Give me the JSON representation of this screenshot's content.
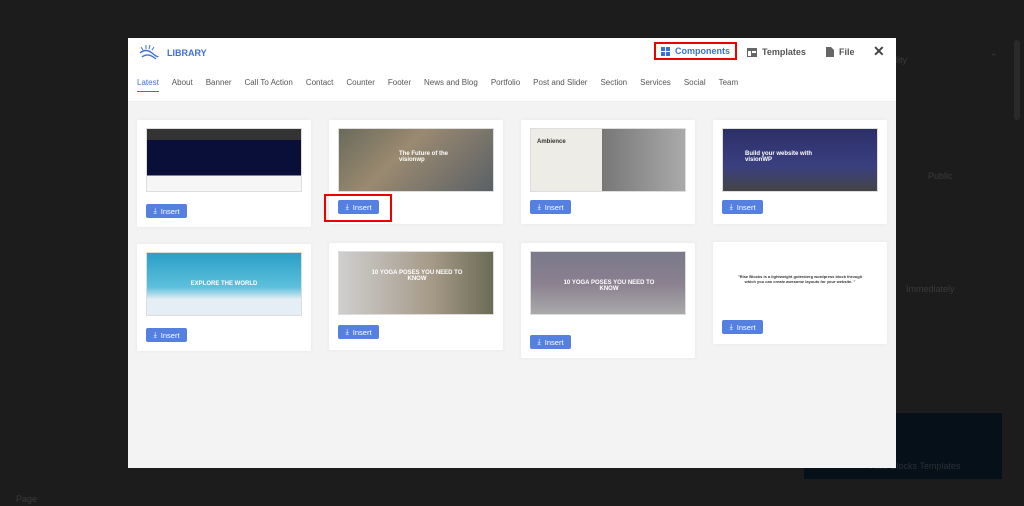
{
  "background": {
    "visibility": "lity",
    "public": "Public",
    "immediately": "Immediately",
    "templates": "Rise Blocks Templates",
    "page": "Page"
  },
  "header": {
    "title": "LIBRARY",
    "buttons": [
      {
        "label": "Components",
        "icon": "grid-icon",
        "active": true
      },
      {
        "label": "Templates",
        "icon": "template-icon"
      },
      {
        "label": "File",
        "icon": "file-icon"
      }
    ],
    "close_icon": "close-icon"
  },
  "tabs": [
    "Latest",
    "About",
    "Banner",
    "Call To Action",
    "Contact",
    "Counter",
    "Footer",
    "News and Blog",
    "Portfolio",
    "Post and Slider",
    "Section",
    "Services",
    "Social",
    "Team"
  ],
  "active_tab": "Latest",
  "insert_label": "Insert",
  "thumbs": {
    "t2": "The Future of the visionwp",
    "t3": "Ambience",
    "t4": "Build your website with visionWP",
    "t5": "EXPLORE THE WORLD",
    "t6": "10 YOGA POSES YOU NEED TO KNOW",
    "t7": "10 YOGA POSES YOU NEED TO KNOW",
    "t8": "\"Rise Blocks is a lightweight gutenberg wordpress block through which you can create awesome layouts for your website. \""
  },
  "colors": {
    "accent": "#3d6fd8",
    "button": "#5580e0",
    "highlight": "#e00000"
  }
}
